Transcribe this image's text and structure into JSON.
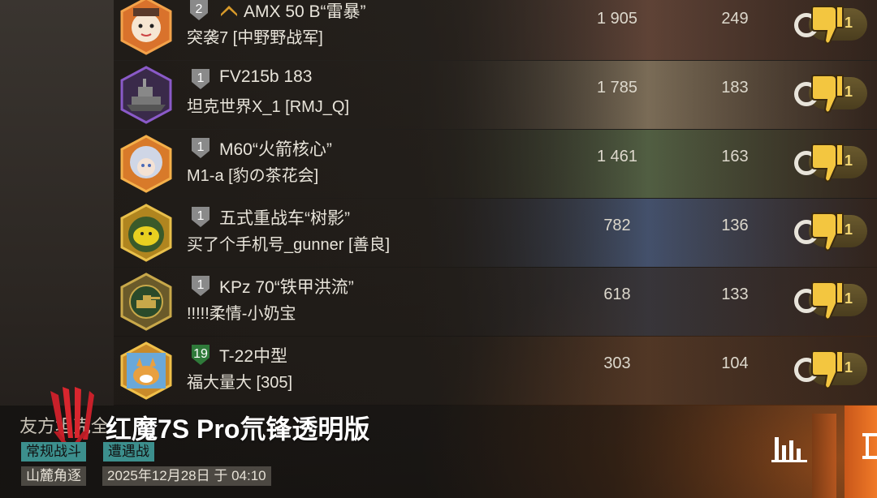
{
  "rows": [
    {
      "tier": "2",
      "rank_icon": "chevron-rank-icon",
      "tank": "AMX 50 B“雷暴”",
      "player": "突袭7 [中野野战军]",
      "damage": "1 905",
      "exp": "249",
      "reports": "1",
      "avatar": "cartoon-face-avatar",
      "tier_color": "#8a8a8a",
      "art": "#6a4a3c"
    },
    {
      "tier": "1",
      "rank_icon": "",
      "tank": "FV215b 183",
      "player": "坦克世界X_1 [RMJ_Q]",
      "damage": "1 785",
      "exp": "183",
      "reports": "1",
      "avatar": "battleship-avatar",
      "tier_color": "#8a8a8a",
      "art": "#8a7a62"
    },
    {
      "tier": "1",
      "rank_icon": "",
      "tank": "M60“火箭核心”",
      "player": "M1-a [豹の茶花会]",
      "damage": "1 461",
      "exp": "163",
      "reports": "1",
      "avatar": "anime-girl-avatar",
      "tier_color": "#8a8a8a",
      "art": "#5a6a4a"
    },
    {
      "tier": "1",
      "rank_icon": "",
      "tank": "五式重战车“树影”",
      "player": "买了个手机号_gunner [善良]",
      "damage": "782",
      "exp": "136",
      "reports": "1",
      "avatar": "yellow-creature-avatar",
      "tier_color": "#8a8a8a",
      "art": "#4a5a7a"
    },
    {
      "tier": "1",
      "rank_icon": "",
      "tank": "KPz 70“铁甲洪流”",
      "player": "!!!!!柔情-小奶宝",
      "damage": "618",
      "exp": "133",
      "reports": "1",
      "avatar": "tank-emblem-avatar",
      "tier_color": "#8a8a8a",
      "art": "#3c3a40"
    },
    {
      "tier": "19",
      "rank_icon": "",
      "tank": "T-22中型",
      "player": "福大量大 [305]",
      "damage": "303",
      "exp": "104",
      "reports": "1",
      "avatar": "fox-cartoon-avatar",
      "tier_color": "#2f7a3a",
      "art": "#5a3c28"
    }
  ],
  "bottom": {
    "truncated_text": "友方坦克全",
    "watermark": "红魔7S Pro氘锋透明版",
    "mode_tag": "常规战斗",
    "battle_type_tag": "遭遇战",
    "map": "山麓角逐",
    "datetime": "2025年12月28日 于 04:10"
  },
  "colors": {
    "accent_orange": "#f07a28",
    "tag_teal": "#3c8f8d",
    "report_gold": "#f3d774"
  }
}
